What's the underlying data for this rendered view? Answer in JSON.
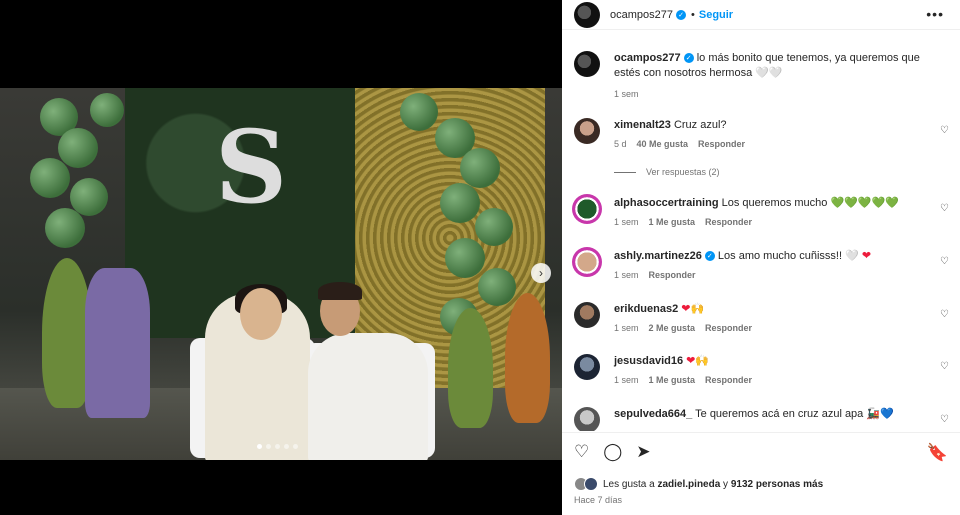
{
  "header": {
    "username": "ocampos277",
    "follow_label": "Seguir",
    "more_label": "•••"
  },
  "media": {
    "next_label": "›",
    "letter": "S"
  },
  "caption": {
    "username": "ocampos277",
    "text": "lo más bonito que tenemos, ya queremos que estés con nosotros hermosa 🤍🤍",
    "time": "1 sem"
  },
  "comments": [
    {
      "username": "ximenalt23",
      "text": "Cruz azul?",
      "time": "5 d",
      "likes": "40 Me gusta",
      "reply": "Responder",
      "view_replies": "Ver respuestas (2)"
    },
    {
      "username": "alphasoccertraining",
      "text": "Los queremos mucho",
      "emoji": "💚💚💚💚💚",
      "time": "1 sem",
      "likes": "1 Me gusta",
      "reply": "Responder"
    },
    {
      "username": "ashly.martinez26",
      "text": "Los amo mucho cuñisss!! 🤍",
      "emoji": "❤",
      "time": "1 sem",
      "reply": "Responder"
    },
    {
      "username": "erikduenas2",
      "text": "",
      "emoji": "❤🙌",
      "time": "1 sem",
      "likes": "2 Me gusta",
      "reply": "Responder"
    },
    {
      "username": "jesusdavid16",
      "text": "",
      "emoji": "❤🙌",
      "time": "1 sem",
      "likes": "1 Me gusta",
      "reply": "Responder"
    },
    {
      "username": "sepulveda664_",
      "text": "Te queremos acá en cruz azul apa 🚂💙"
    }
  ],
  "actions": {
    "like_icon": "♡",
    "comment_icon": "◯",
    "share_icon": "➤",
    "save_icon": "🔖"
  },
  "likes": {
    "prefix": "Les gusta a ",
    "user": "zadiel.pineda",
    "middle": " y ",
    "count": "9132 personas más"
  },
  "posted": "Hace 7 días",
  "colors": {
    "accent": "#0095f6",
    "muted": "#737373"
  }
}
